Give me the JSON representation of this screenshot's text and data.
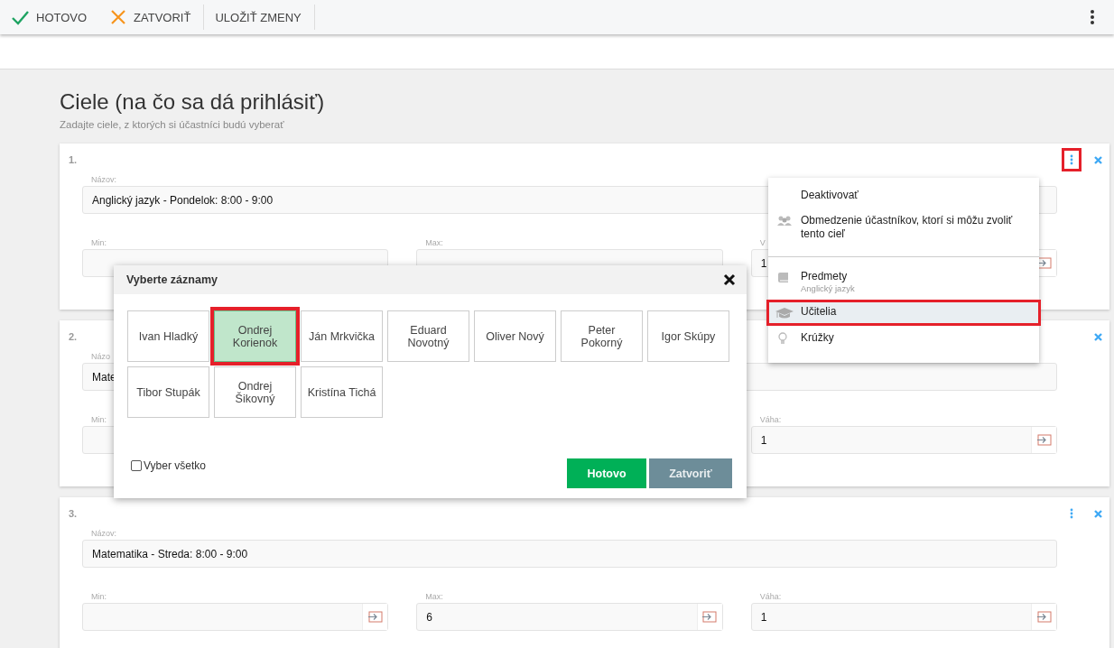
{
  "toolbar": {
    "buttons": [
      {
        "kind": "check",
        "label": "HOTOVO"
      },
      {
        "kind": "close",
        "label": "ZATVORIŤ"
      },
      {
        "kind": "plain",
        "label": "ULOŽIŤ ZMENY"
      }
    ]
  },
  "heading": {
    "title": "Ciele (na čo sa dá prihlásiť)",
    "subtitle": "Zadajte ciele, z ktorých si účastníci budú vyberať"
  },
  "cards": [
    {
      "number": "1.",
      "menu_icon": true,
      "menu_highlighted": true,
      "name_label": "Názov:",
      "name_value": "Anglický jazyk - Pondelok: 8:00 - 9:00",
      "fields": [
        {
          "label": "Min:",
          "action_icon": false
        },
        {
          "label": "Max:",
          "action_icon": false
        },
        {
          "label": "V",
          "value": "1",
          "action_icon": true
        }
      ]
    },
    {
      "number": "2.",
      "menu_icon": false,
      "menu_highlighted": false,
      "name_label": "Názo",
      "name_value": "Mate",
      "fields": [
        {
          "label": "Min:",
          "action_icon": false
        },
        {
          "label": "Váha:",
          "value": "1",
          "action_icon": true
        }
      ]
    },
    {
      "number": "3.",
      "menu_icon": true,
      "menu_highlighted": false,
      "name_label": "Názov:",
      "name_value": "Matematika - Streda: 8:00 - 9:00",
      "fields": [
        {
          "label": "Min:",
          "action_icon": true
        },
        {
          "label": "Max:",
          "value": "6",
          "action_icon": true
        },
        {
          "label": "Váha:",
          "value": "1",
          "action_icon": true
        }
      ]
    }
  ],
  "context_menu": {
    "items": [
      {
        "kind": "plain",
        "label": "Deaktivovať",
        "highlighted": false
      },
      {
        "kind": "people",
        "label": "Obmedzenie účastníkov, ktorí si môžu zvoliť tento cieľ",
        "highlighted": false,
        "divider_after": true
      },
      {
        "kind": "book",
        "label": "Predmety",
        "sublabel": "Anglický jazyk",
        "highlighted": false
      },
      {
        "kind": "cap",
        "label": "Učitelia",
        "highlighted": true
      },
      {
        "kind": "bulb",
        "label": "Krúžky",
        "highlighted": false
      }
    ]
  },
  "dialog": {
    "title": "Vyberte záznamy",
    "options": [
      {
        "label": "Ivan Hladký",
        "selected": false,
        "highlighted": false
      },
      {
        "label": "Ondrej Korienok",
        "selected": true,
        "highlighted": true
      },
      {
        "label": "Ján Mrkvička",
        "selected": false,
        "highlighted": false
      },
      {
        "label": "Eduard Novotný",
        "selected": false,
        "highlighted": false
      },
      {
        "label": "Oliver Nový",
        "selected": false,
        "highlighted": false
      },
      {
        "label": "Peter Pokorný",
        "selected": false,
        "highlighted": false
      },
      {
        "label": "Igor Skúpy",
        "selected": false,
        "highlighted": false
      },
      {
        "label": "Tibor Stupák",
        "selected": false,
        "highlighted": false
      },
      {
        "label": "Ondrej Šikovný",
        "selected": false,
        "highlighted": false
      },
      {
        "label": "Kristína Tichá",
        "selected": false,
        "highlighted": false
      }
    ],
    "select_all": {
      "label": "Vyber všetko",
      "checked": false
    },
    "buttons": [
      {
        "kind": "primary",
        "label": "Hotovo"
      },
      {
        "kind": "secondary",
        "label": "Zatvoriť"
      }
    ]
  }
}
